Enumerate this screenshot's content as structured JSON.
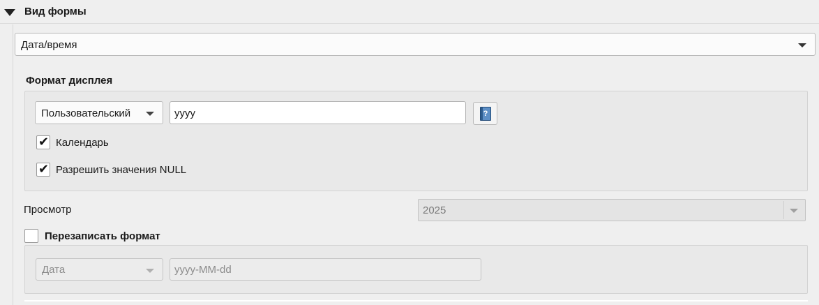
{
  "section": {
    "title": "Вид формы"
  },
  "widget_type": {
    "selected": "Дата/время"
  },
  "display_format": {
    "title": "Формат дисплея",
    "format_type": "Пользовательский",
    "format_value": "yyyy",
    "help_icon": "help-book-icon",
    "calendar": {
      "label": "Календарь",
      "checked": true
    },
    "allow_null": {
      "label": "Разрешить значения NULL",
      "checked": true
    }
  },
  "preview": {
    "label": "Просмотр",
    "value": "2025"
  },
  "override_format": {
    "title": "Перезаписать формат",
    "checked": false,
    "type": "Дата",
    "value": "yyyy-MM-dd"
  }
}
